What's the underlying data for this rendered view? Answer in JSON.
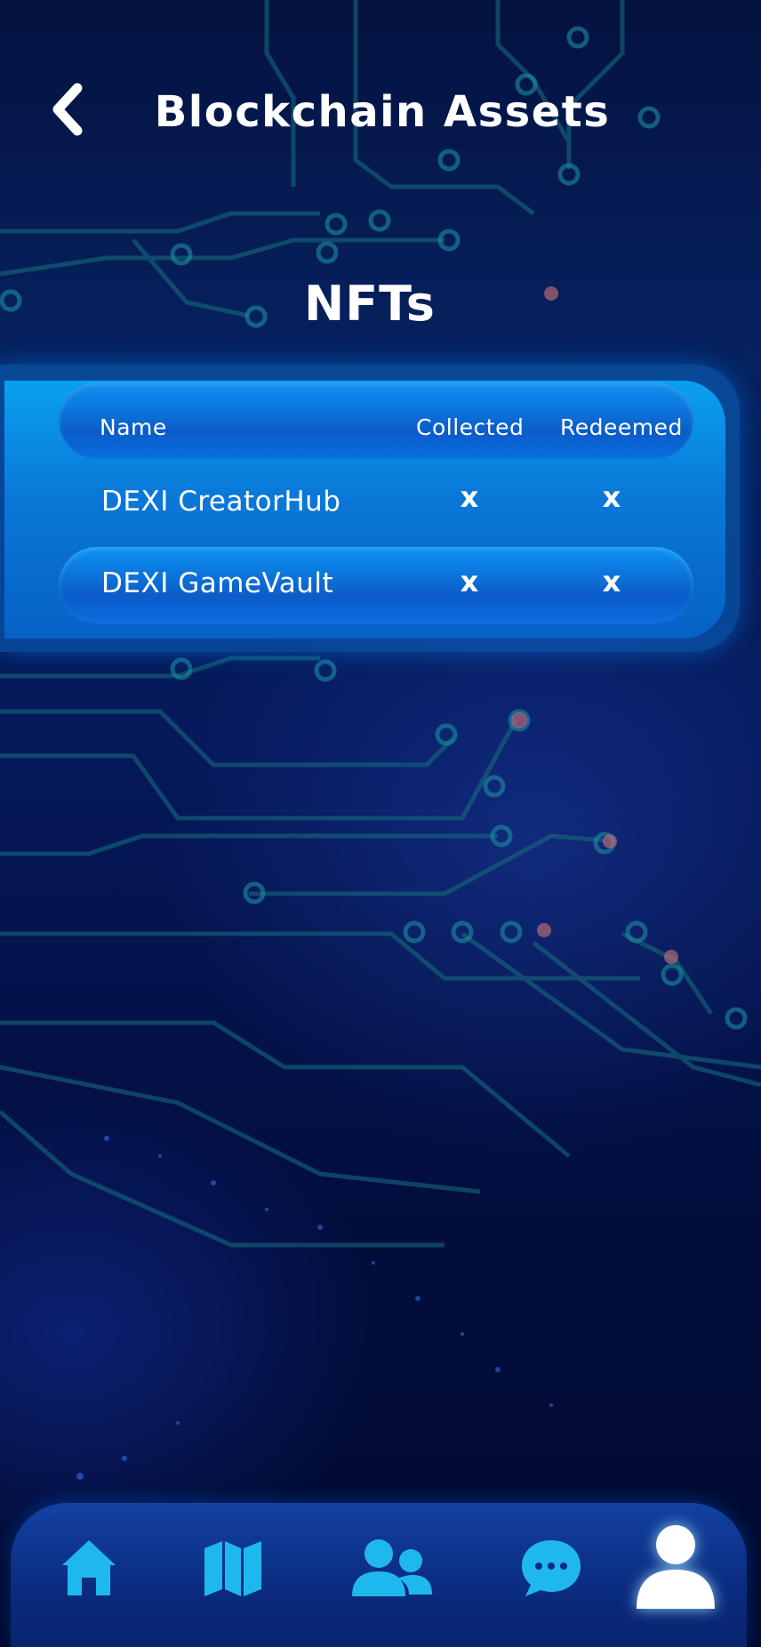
{
  "header": {
    "title": "Blockchain Assets",
    "back_icon": "chevron-left-icon"
  },
  "section": {
    "title": "NFTs"
  },
  "nft_table": {
    "columns": [
      "Name",
      "Collected",
      "Redeemed"
    ],
    "rows": [
      {
        "name": "DEXI CreatorHub",
        "collected": "x",
        "redeemed": "x"
      },
      {
        "name": "DEXI GameVault",
        "collected": "x",
        "redeemed": "x"
      }
    ]
  },
  "bottom_nav": {
    "items": [
      {
        "icon": "home-icon",
        "active": false
      },
      {
        "icon": "map-icon",
        "active": false
      },
      {
        "icon": "users-icon",
        "active": false
      },
      {
        "icon": "chat-icon",
        "active": false
      },
      {
        "icon": "profile-icon",
        "active": true
      }
    ]
  },
  "colors": {
    "accent": "#1fb8ee",
    "active_icon": "#ffffff",
    "panel": "#0a78d8",
    "background": "#041240"
  }
}
